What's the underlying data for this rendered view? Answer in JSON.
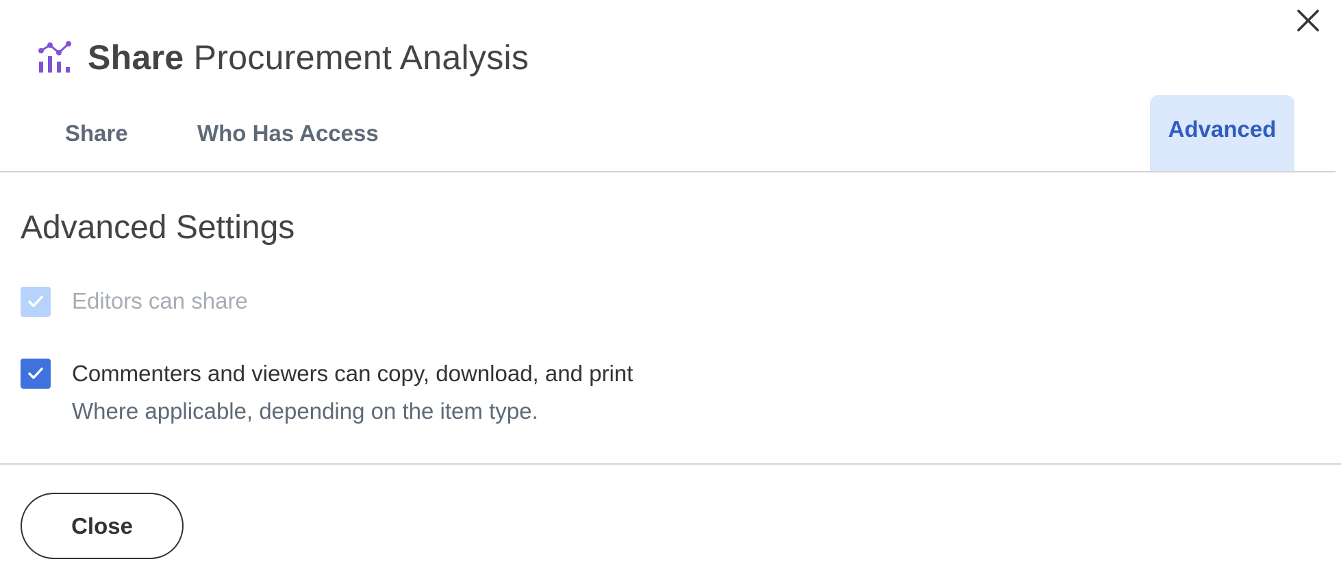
{
  "dialog": {
    "title_action": "Share",
    "title_item": "Procurement Analysis",
    "app_icon": "analytics-chart-icon",
    "close_icon": "close-icon",
    "accent_color": "#3f72dc",
    "icon_color": "#7f52d6"
  },
  "tabs": {
    "share": "Share",
    "who_has_access": "Who Has Access",
    "advanced": "Advanced",
    "selected": "Advanced"
  },
  "advanced": {
    "heading": "Advanced Settings",
    "options": [
      {
        "label": "Editors can share",
        "checked": true,
        "disabled": true
      },
      {
        "label": "Commenters and viewers can copy, download, and print",
        "description": "Where applicable, depending on the item type.",
        "checked": true,
        "disabled": false
      }
    ]
  },
  "footer": {
    "close_label": "Close"
  }
}
